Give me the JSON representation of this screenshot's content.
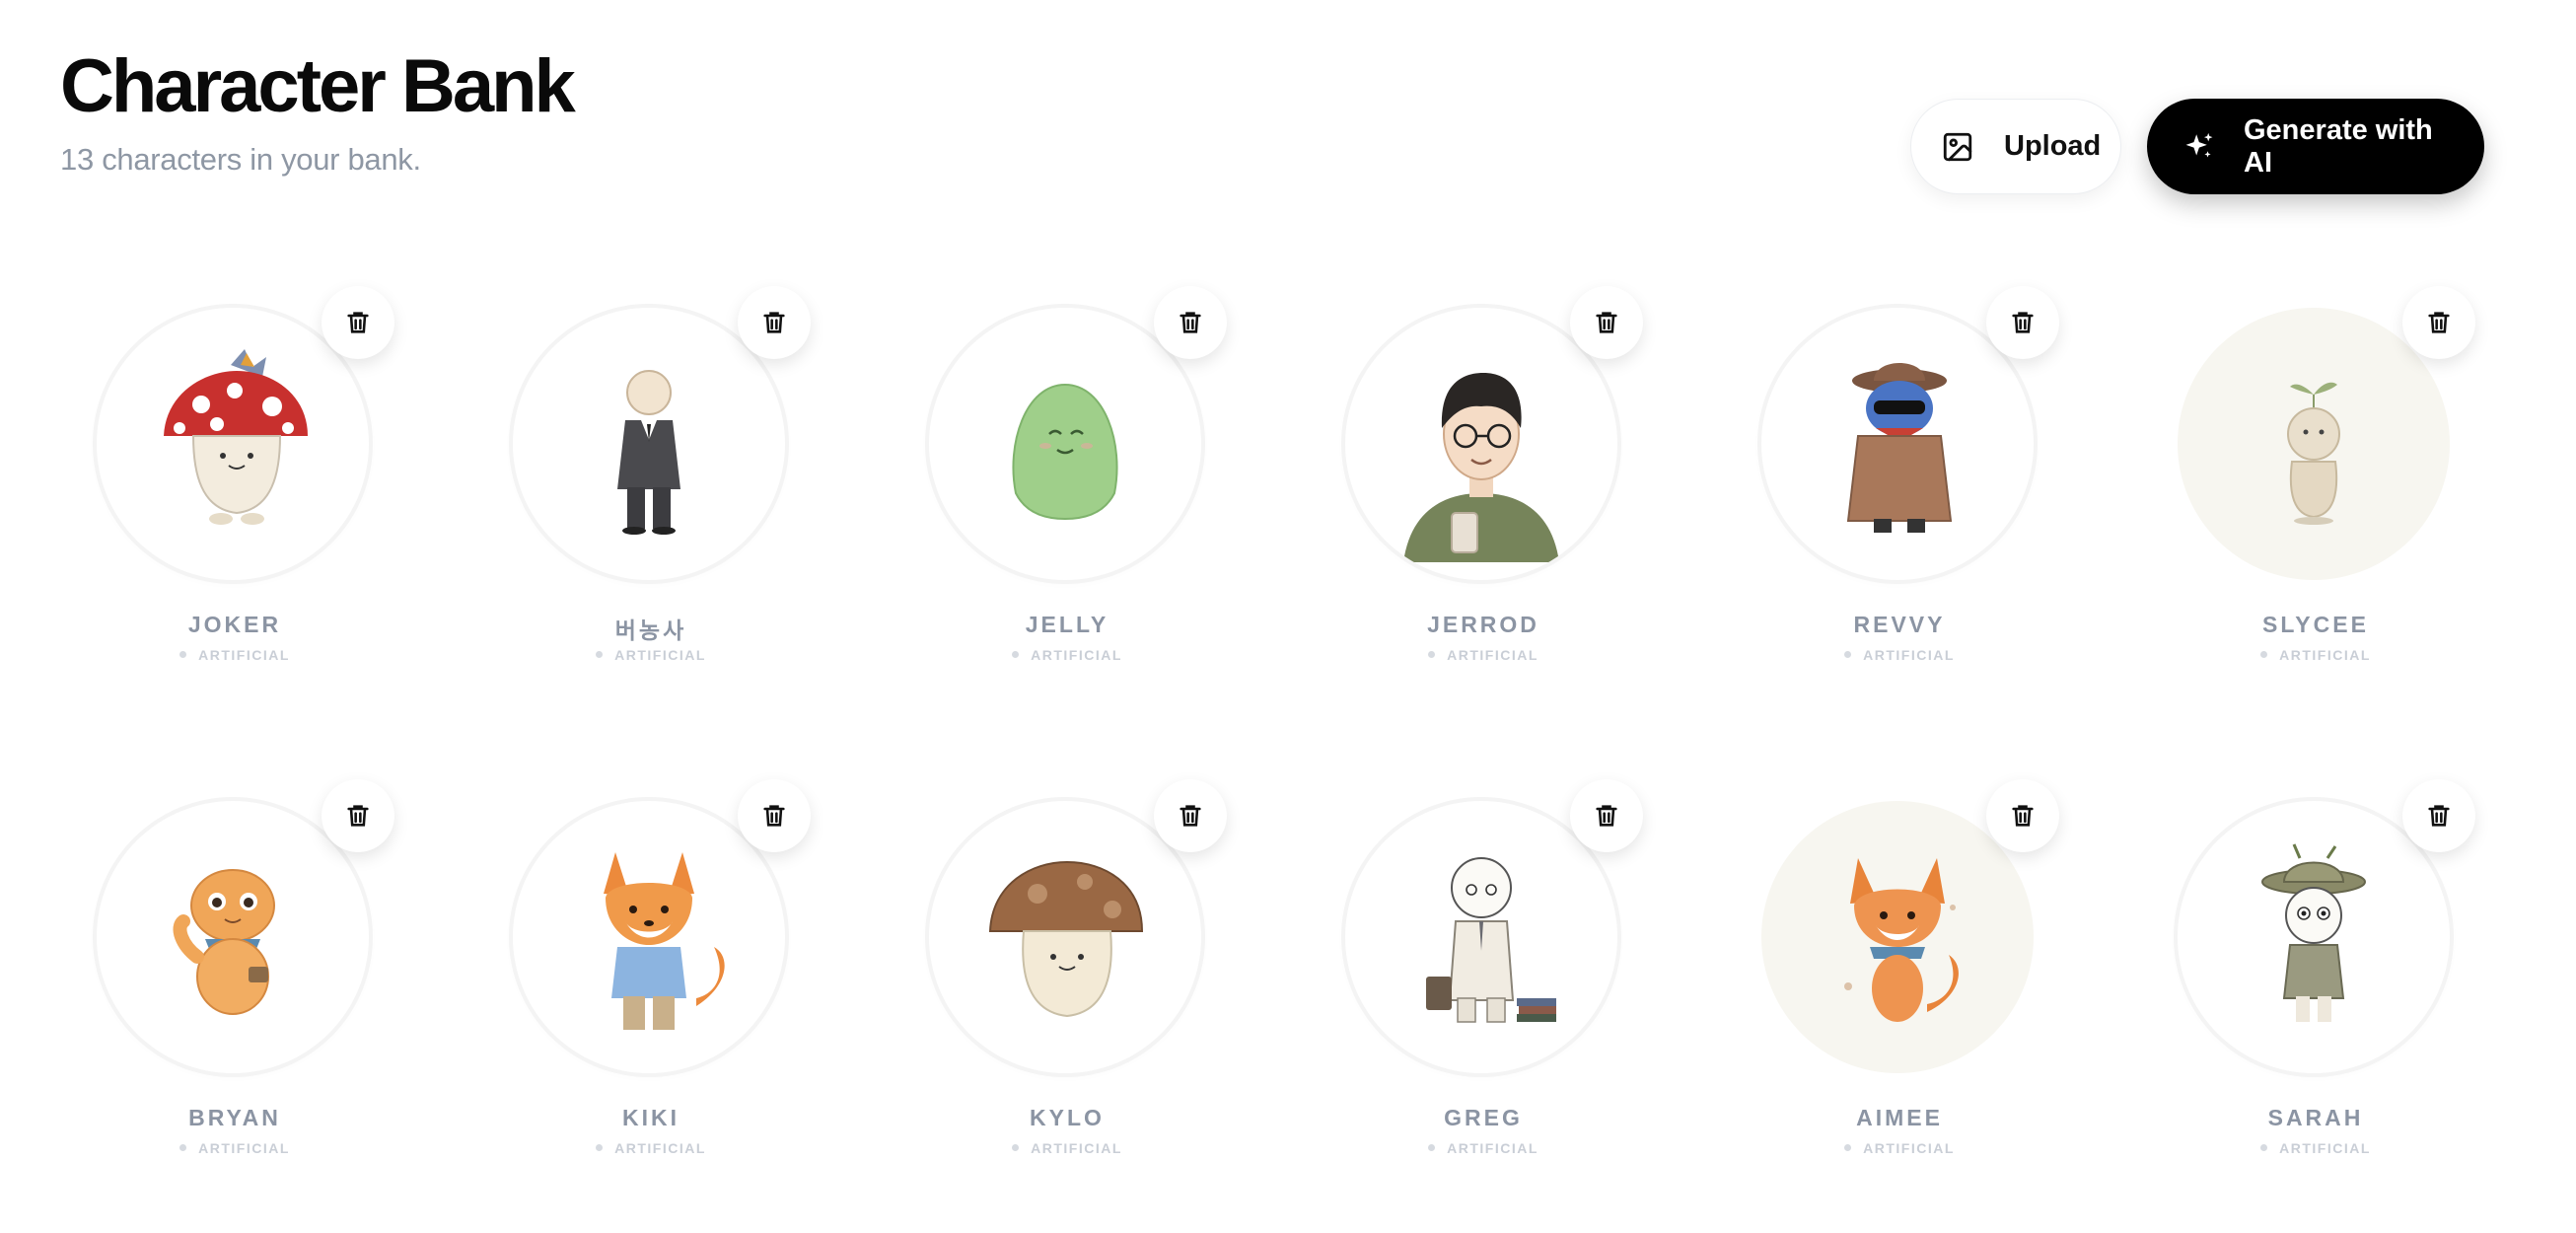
{
  "header": {
    "title": "Character Bank",
    "subtitle": "13 characters in your bank."
  },
  "actions": {
    "upload_label": "Upload",
    "upload_icon": "image-icon",
    "generate_label": "Generate with AI",
    "generate_icon": "sparkles-icon"
  },
  "characters": [
    {
      "name": "JOKER",
      "tag": "ARTIFICIAL"
    },
    {
      "name": "버농사",
      "tag": "ARTIFICIAL"
    },
    {
      "name": "JELLY",
      "tag": "ARTIFICIAL"
    },
    {
      "name": "JERROD",
      "tag": "ARTIFICIAL"
    },
    {
      "name": "REVVY",
      "tag": "ARTIFICIAL"
    },
    {
      "name": "SLYCEE",
      "tag": "ARTIFICIAL"
    },
    {
      "name": "BRYAN",
      "tag": "ARTIFICIAL"
    },
    {
      "name": "KIKI",
      "tag": "ARTIFICIAL"
    },
    {
      "name": "KYLO",
      "tag": "ARTIFICIAL"
    },
    {
      "name": "GREG",
      "tag": "ARTIFICIAL"
    },
    {
      "name": "AIMEE",
      "tag": "ARTIFICIAL"
    },
    {
      "name": "SARAH",
      "tag": "ARTIFICIAL"
    }
  ],
  "delete_icon": "trash-icon"
}
